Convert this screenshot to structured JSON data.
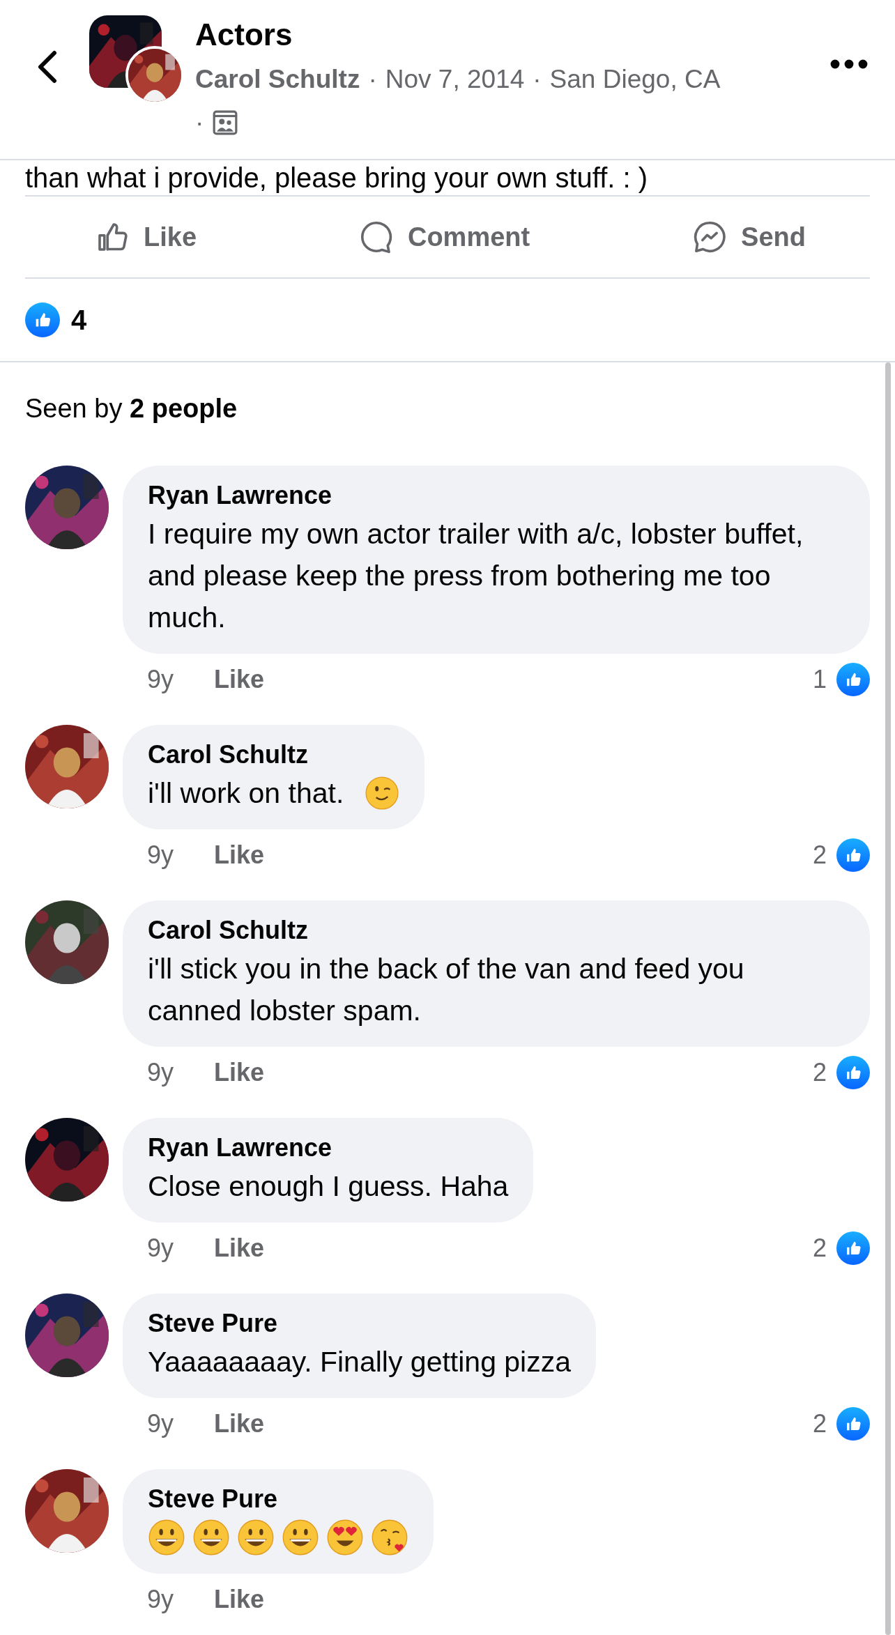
{
  "header": {
    "title": "Actors",
    "meta": [
      {
        "kind": "author",
        "text": "Carol Schultz"
      },
      {
        "kind": "separator",
        "text": "·"
      },
      {
        "kind": "plain",
        "text": "Nov 7, 2014"
      },
      {
        "kind": "separator",
        "text": "·"
      },
      {
        "kind": "plain",
        "text": "San Diego, CA"
      }
    ],
    "audience": {
      "separator": "·"
    }
  },
  "post_text": "than what i provide, please bring your own stuff. : )",
  "actions": [
    {
      "kind": "like",
      "label": "Like"
    },
    {
      "kind": "comment",
      "label": "Comment"
    },
    {
      "kind": "send",
      "label": "Send"
    }
  ],
  "reactions": {
    "count": "4"
  },
  "seen_by": "Seen by **2 people**",
  "comments": [
    {
      "author": "Ryan Lawrence",
      "text": "I require my own actor trailer with a/c, lobster buffet, and please keep the press from bothering me too much.",
      "time": "9y",
      "like_label": "Like",
      "likes": "1"
    },
    {
      "author": "Carol Schultz",
      "text": "i'll work on that.",
      "emojis": [
        {
          "kind": "wink"
        }
      ],
      "time": "9y",
      "like_label": "Like",
      "likes": "2"
    },
    {
      "author": "Carol Schultz",
      "text": "i'll stick you in the back of the van and feed you canned lobster spam.",
      "time": "9y",
      "like_label": "Like",
      "likes": "2"
    },
    {
      "author": "Ryan Lawrence",
      "text": "Close enough I guess. Haha",
      "time": "9y",
      "like_label": "Like",
      "likes": "2"
    },
    {
      "author": "Steve Pure",
      "text": "Yaaaaaaaay. Finally getting pizza",
      "time": "9y",
      "like_label": "Like",
      "likes": "2"
    },
    {
      "author": "Steve Pure",
      "emojis": [
        {
          "kind": "grin"
        },
        {
          "kind": "grin"
        },
        {
          "kind": "grin"
        },
        {
          "kind": "grin"
        },
        {
          "kind": "heart_eyes"
        },
        {
          "kind": "kiss"
        }
      ],
      "time": "9y",
      "like_label": "Like"
    }
  ]
}
